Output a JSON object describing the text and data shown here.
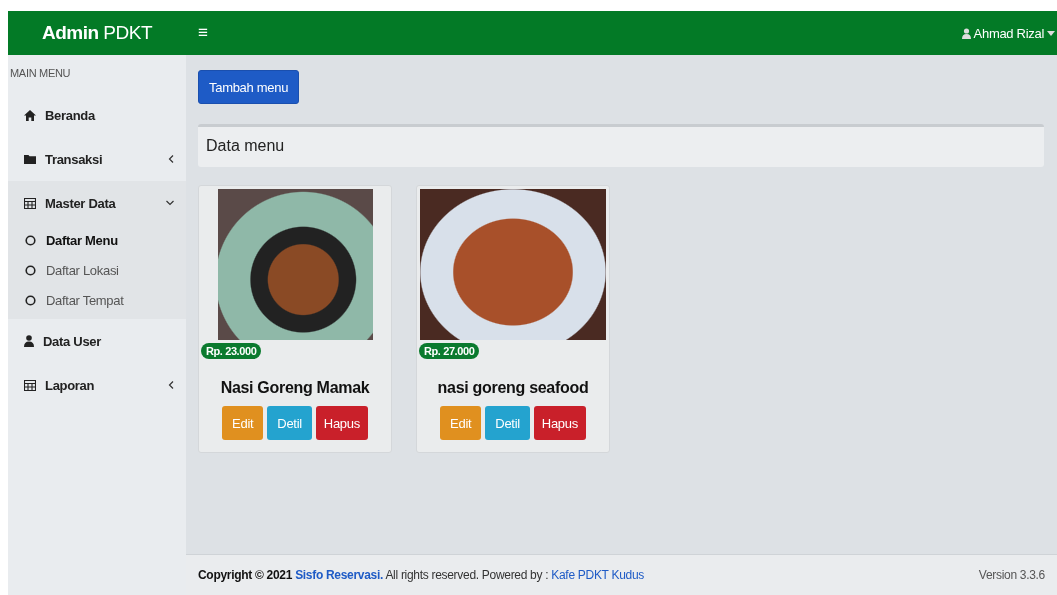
{
  "brand": {
    "bold": "Admin",
    "rest": "PDKT"
  },
  "navbar": {
    "toggle": "≡",
    "user": "Ahmad Rizal"
  },
  "sidebar": {
    "header": "MAIN MENU",
    "items": [
      {
        "label": "Beranda",
        "kind": "link"
      },
      {
        "label": "Transaksi",
        "kind": "dropdown",
        "expanded": false
      },
      {
        "label": "Master Data",
        "kind": "dropdown",
        "expanded": true,
        "children": [
          {
            "label": "Daftar Menu",
            "selected": true
          },
          {
            "label": "Daftar Lokasi",
            "selected": false
          },
          {
            "label": "Daftar Tempat",
            "selected": false
          }
        ]
      },
      {
        "label": "Data User",
        "kind": "link"
      },
      {
        "label": "Laporan",
        "kind": "dropdown",
        "expanded": false
      }
    ]
  },
  "add_button": "Tambah menu",
  "section_title": "Data menu",
  "menu_cards": [
    {
      "price": "Rp. 23.000",
      "name": "Nasi Goreng Mamak",
      "buttons": [
        {
          "label": "Edit",
          "kind": "edit"
        },
        {
          "label": "Detil",
          "kind": "detail"
        },
        {
          "label": "Hapus",
          "kind": "delete"
        }
      ]
    },
    {
      "price": "Rp. 27.000",
      "name": "nasi goreng seafood",
      "buttons": [
        {
          "label": "Edit",
          "kind": "edit"
        },
        {
          "label": "Detil",
          "kind": "detail"
        },
        {
          "label": "Hapus",
          "kind": "delete"
        }
      ]
    }
  ],
  "footer": {
    "copyright": "Copyright © 2021",
    "app_link": "Sisfo Reservasi.",
    "rights": "All rights reserved. Powered by :",
    "powered_link": "Kafe PDKT Kudus",
    "version": "Version 3.3.6"
  }
}
